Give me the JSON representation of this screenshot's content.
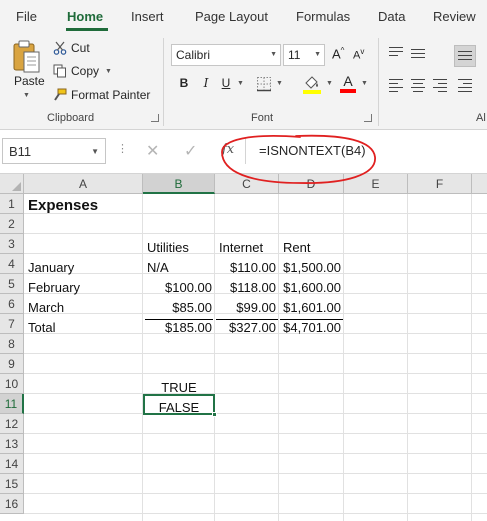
{
  "tabs": [
    "File",
    "Home",
    "Insert",
    "Page Layout",
    "Formulas",
    "Data",
    "Review"
  ],
  "active_tab": "Home",
  "clipboard": {
    "paste_label": "Paste",
    "cut_label": "Cut",
    "copy_label": "Copy",
    "format_painter_label": "Format Painter",
    "group_label": "Clipboard"
  },
  "font": {
    "name": "Calibri",
    "size": "11",
    "grow_label": "A",
    "shrink_label": "A",
    "bold_label": "B",
    "italic_label": "I",
    "underline_label": "U",
    "font_color_label": "A",
    "group_label": "Font",
    "fill_color": "#ffff00",
    "font_color": "#ff0000"
  },
  "alignment": {
    "group_label": "Al"
  },
  "formula_bar": {
    "name_box": "B11",
    "cancel_label": "✕",
    "enter_label": "✓",
    "fx_label": "fx",
    "formula": "=ISNONTEXT(B4)"
  },
  "columns": [
    "A",
    "B",
    "C",
    "D",
    "E",
    "F"
  ],
  "selected_column": "B",
  "rows": [
    "1",
    "2",
    "3",
    "4",
    "5",
    "6",
    "7",
    "8",
    "9",
    "10",
    "11",
    "12",
    "13",
    "14",
    "15",
    "16"
  ],
  "selected_row": "11",
  "cells": {
    "A1": "Expenses",
    "B3": "Utilities",
    "C3": "Internet",
    "D3": "Rent",
    "A4": "January",
    "B4": "N/A",
    "C4": "$110.00",
    "D4": "$1,500.00",
    "A5": "February",
    "B5": "$100.00",
    "C5": "$118.00",
    "D5": "$1,600.00",
    "A6": "March",
    "B6": "$85.00",
    "C6": "$99.00",
    "D6": "$1,601.00",
    "A7": "Total",
    "B7": "$185.00",
    "C7": "$327.00",
    "D7": "$4,701.00",
    "B10": "TRUE",
    "B11": "FALSE"
  },
  "colors": {
    "accent": "#217346",
    "annotation": "#e02020"
  }
}
